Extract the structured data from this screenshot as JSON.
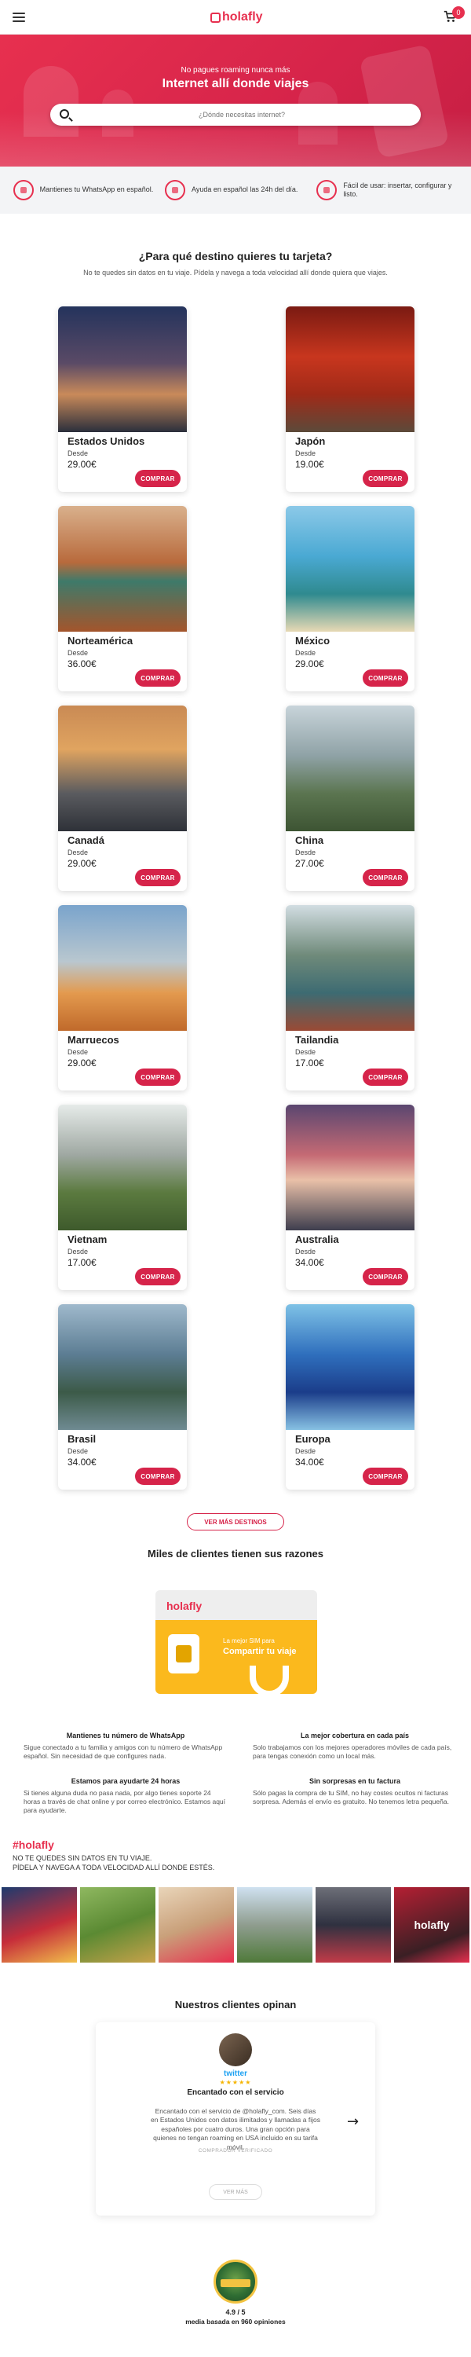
{
  "header": {
    "logo": "holafly",
    "cart_count": "0"
  },
  "hero": {
    "subtitle": "No pagues roaming nunca más",
    "title": "Internet allí donde viajes",
    "search_placeholder": "¿Dónde necesitas internet?"
  },
  "features": [
    {
      "text": "Mantienes tu WhatsApp en español."
    },
    {
      "text": "Ayuda en español las 24h del día."
    },
    {
      "text": "Fácil de usar: insertar, configurar y listo."
    }
  ],
  "destinations": {
    "title": "¿Para qué destino quieres tu tarjeta?",
    "subtitle": "No te quedes sin datos en tu viaje. Pídela y navega a toda velocidad allí donde quiera que viajes.",
    "from_label": "Desde",
    "buy_label": "COMPRAR",
    "items": [
      {
        "name": "Estados Unidos",
        "price": "29.00€"
      },
      {
        "name": "Japón",
        "price": "19.00€"
      },
      {
        "name": "Norteamérica",
        "price": "36.00€"
      },
      {
        "name": "México",
        "price": "29.00€"
      },
      {
        "name": "Canadá",
        "price": "29.00€"
      },
      {
        "name": "China",
        "price": "27.00€"
      },
      {
        "name": "Marruecos",
        "price": "29.00€"
      },
      {
        "name": "Tailandia",
        "price": "17.00€"
      },
      {
        "name": "Vietnam",
        "price": "17.00€"
      },
      {
        "name": "Australia",
        "price": "34.00€"
      },
      {
        "name": "Brasil",
        "price": "34.00€"
      },
      {
        "name": "Europa",
        "price": "34.00€"
      }
    ],
    "more_label": "VER MÁS DESTINOS"
  },
  "reasons": {
    "title": "Miles de clientes tienen sus razones",
    "promo_logo": "holafly",
    "promo_small": "La mejor SIM para",
    "promo_big": "Compartir tu viaje",
    "items": [
      {
        "title": "Mantienes tu número de WhatsApp",
        "text": "Sigue conectado a tu familia y amigos con tu número de WhatsApp español. Sin necesidad de que configures nada."
      },
      {
        "title": "La mejor cobertura en cada país",
        "text": "Solo trabajamos con los mejores operadores móviles de cada país, para tengas conexión como un local más."
      },
      {
        "title": "Estamos para ayudarte 24 horas",
        "text": "Si tienes alguna duda no pasa nada, por algo tienes soporte 24 horas a través de chat online y por correo electrónico. Estamos aquí para ayudarte."
      },
      {
        "title": "Sin sorpresas en tu factura",
        "text": "Sólo pagas la compra de tu SIM, no hay costes ocultos ni facturas sorpresa. Además el envío es gratuito. No tenemos letra pequeña."
      }
    ]
  },
  "social": {
    "hashtag": "#holafly",
    "line1": "NO TE QUEDES SIN DATOS EN TU VIAJE.",
    "line2": "PÍDELA Y NAVEGA A TODA VELOCIDAD ALLÍ DONDE ESTÉS.",
    "watermark": "holafly"
  },
  "reviews": {
    "title": "Nuestros clientes opinan",
    "source": "twitter",
    "stars": "★★★★★",
    "review_title": "Encantado con el servicio",
    "review_text": "Encantado con el servicio de @holafly_com. Seis días en Estados Unidos con datos ilimitados y llamadas a fijos españoles por cuatro duros. Una gran opción para quienes no tengan roaming en USA incluido en su tarifa móvil.",
    "verified": "COMPRADOR VERIFICADO",
    "see_more": "VER MÁS",
    "prev": "←",
    "next": "→"
  },
  "rating": {
    "score": "4.9 / 5",
    "basis": "media basada en 960 opiniones"
  },
  "colors": {
    "brand": "#e7304f",
    "button": "#d6244a",
    "promo_yellow": "#fbb91d"
  }
}
